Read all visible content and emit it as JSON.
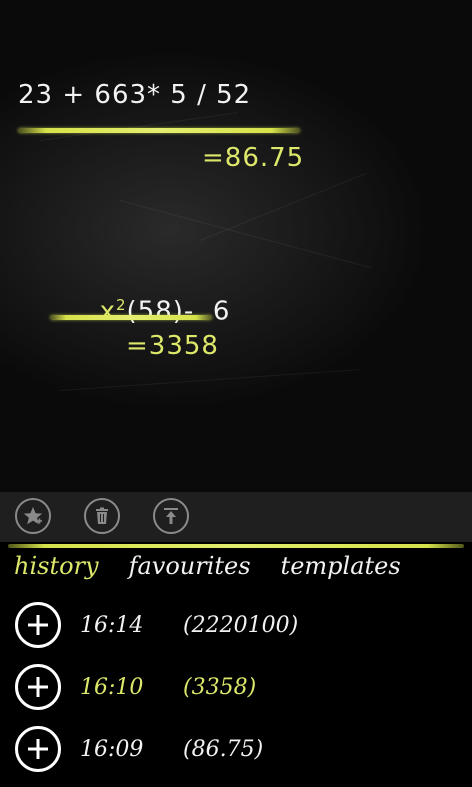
{
  "board": {
    "expr1": {
      "expression": "23 + 663* 5 / 52",
      "result": "=86.75"
    },
    "expr2": {
      "expression_base": "x",
      "expression_sup": "2",
      "expression_rest": "(58)-  6",
      "result": "=3358"
    }
  },
  "appbar": {
    "buttons": [
      {
        "name": "favourite-add",
        "icon": "star-icon"
      },
      {
        "name": "delete",
        "icon": "trash-icon"
      },
      {
        "name": "move-top",
        "icon": "upload-icon"
      }
    ]
  },
  "tabs": [
    {
      "label": "history",
      "active": true
    },
    {
      "label": "favourites",
      "active": false
    },
    {
      "label": "templates",
      "active": false
    }
  ],
  "history": [
    {
      "time": "16:14",
      "value": "(2220100)",
      "highlighted": false
    },
    {
      "time": "16:10",
      "value": "(3358)",
      "highlighted": true
    },
    {
      "time": "16:09",
      "value": "(86.75)",
      "highlighted": false
    }
  ],
  "colors": {
    "accent": "#dde86a",
    "text": "#f2f2f2",
    "appbar": "#1f1f1f"
  }
}
